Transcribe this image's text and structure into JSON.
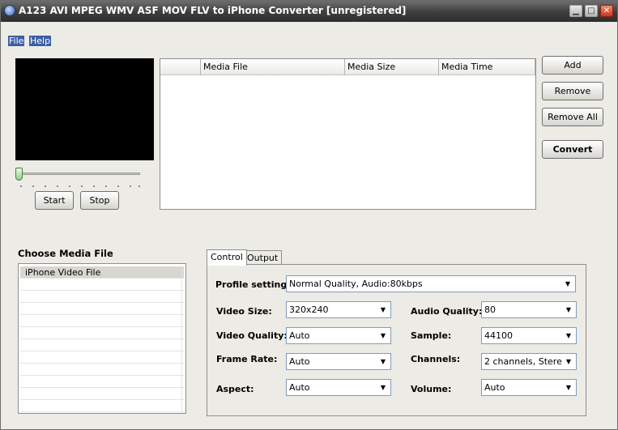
{
  "window": {
    "title": "A123 AVI MPEG WMV ASF MOV FLV to iPhone Converter  [unregistered]",
    "controls": {
      "minimize": "▁",
      "maximize": "□",
      "close": "✕"
    }
  },
  "menu": [
    {
      "label": "File"
    },
    {
      "label": "Help"
    }
  ],
  "player": {
    "start_label": "Start",
    "stop_label": "Stop",
    "position": 0
  },
  "media_list": {
    "columns": [
      "",
      "Media File",
      "Media Size",
      "Media Time"
    ],
    "rows": []
  },
  "actions": {
    "add": "Add",
    "remove": "Remove",
    "remove_all": "Remove All",
    "convert": "Convert"
  },
  "choose": {
    "title": "Choose Media File",
    "items": [
      "iPhone Video File",
      "",
      "",
      "",
      "",
      "",
      "",
      "",
      "",
      "",
      "",
      ""
    ]
  },
  "tabs": {
    "control": "Control",
    "output": "Output",
    "active": "Control"
  },
  "settings": {
    "profile": {
      "label": "Profile setting:",
      "value": "Normal Quality, Audio:80kbps"
    },
    "video_size": {
      "label": "Video Size:",
      "value": "320x240"
    },
    "video_quality": {
      "label": "Video Quality:",
      "value": "Auto"
    },
    "frame_rate": {
      "label": "Frame Rate:",
      "value": "Auto"
    },
    "aspect": {
      "label": "Aspect:",
      "value": "Auto"
    },
    "audio_quality": {
      "label": "Audio Quality:",
      "value": "80"
    },
    "sample": {
      "label": "Sample:",
      "value": "44100"
    },
    "channels": {
      "label": "Channels:",
      "value": "2 channels, Stere"
    },
    "volume": {
      "label": "Volume:",
      "value": "Auto"
    }
  }
}
